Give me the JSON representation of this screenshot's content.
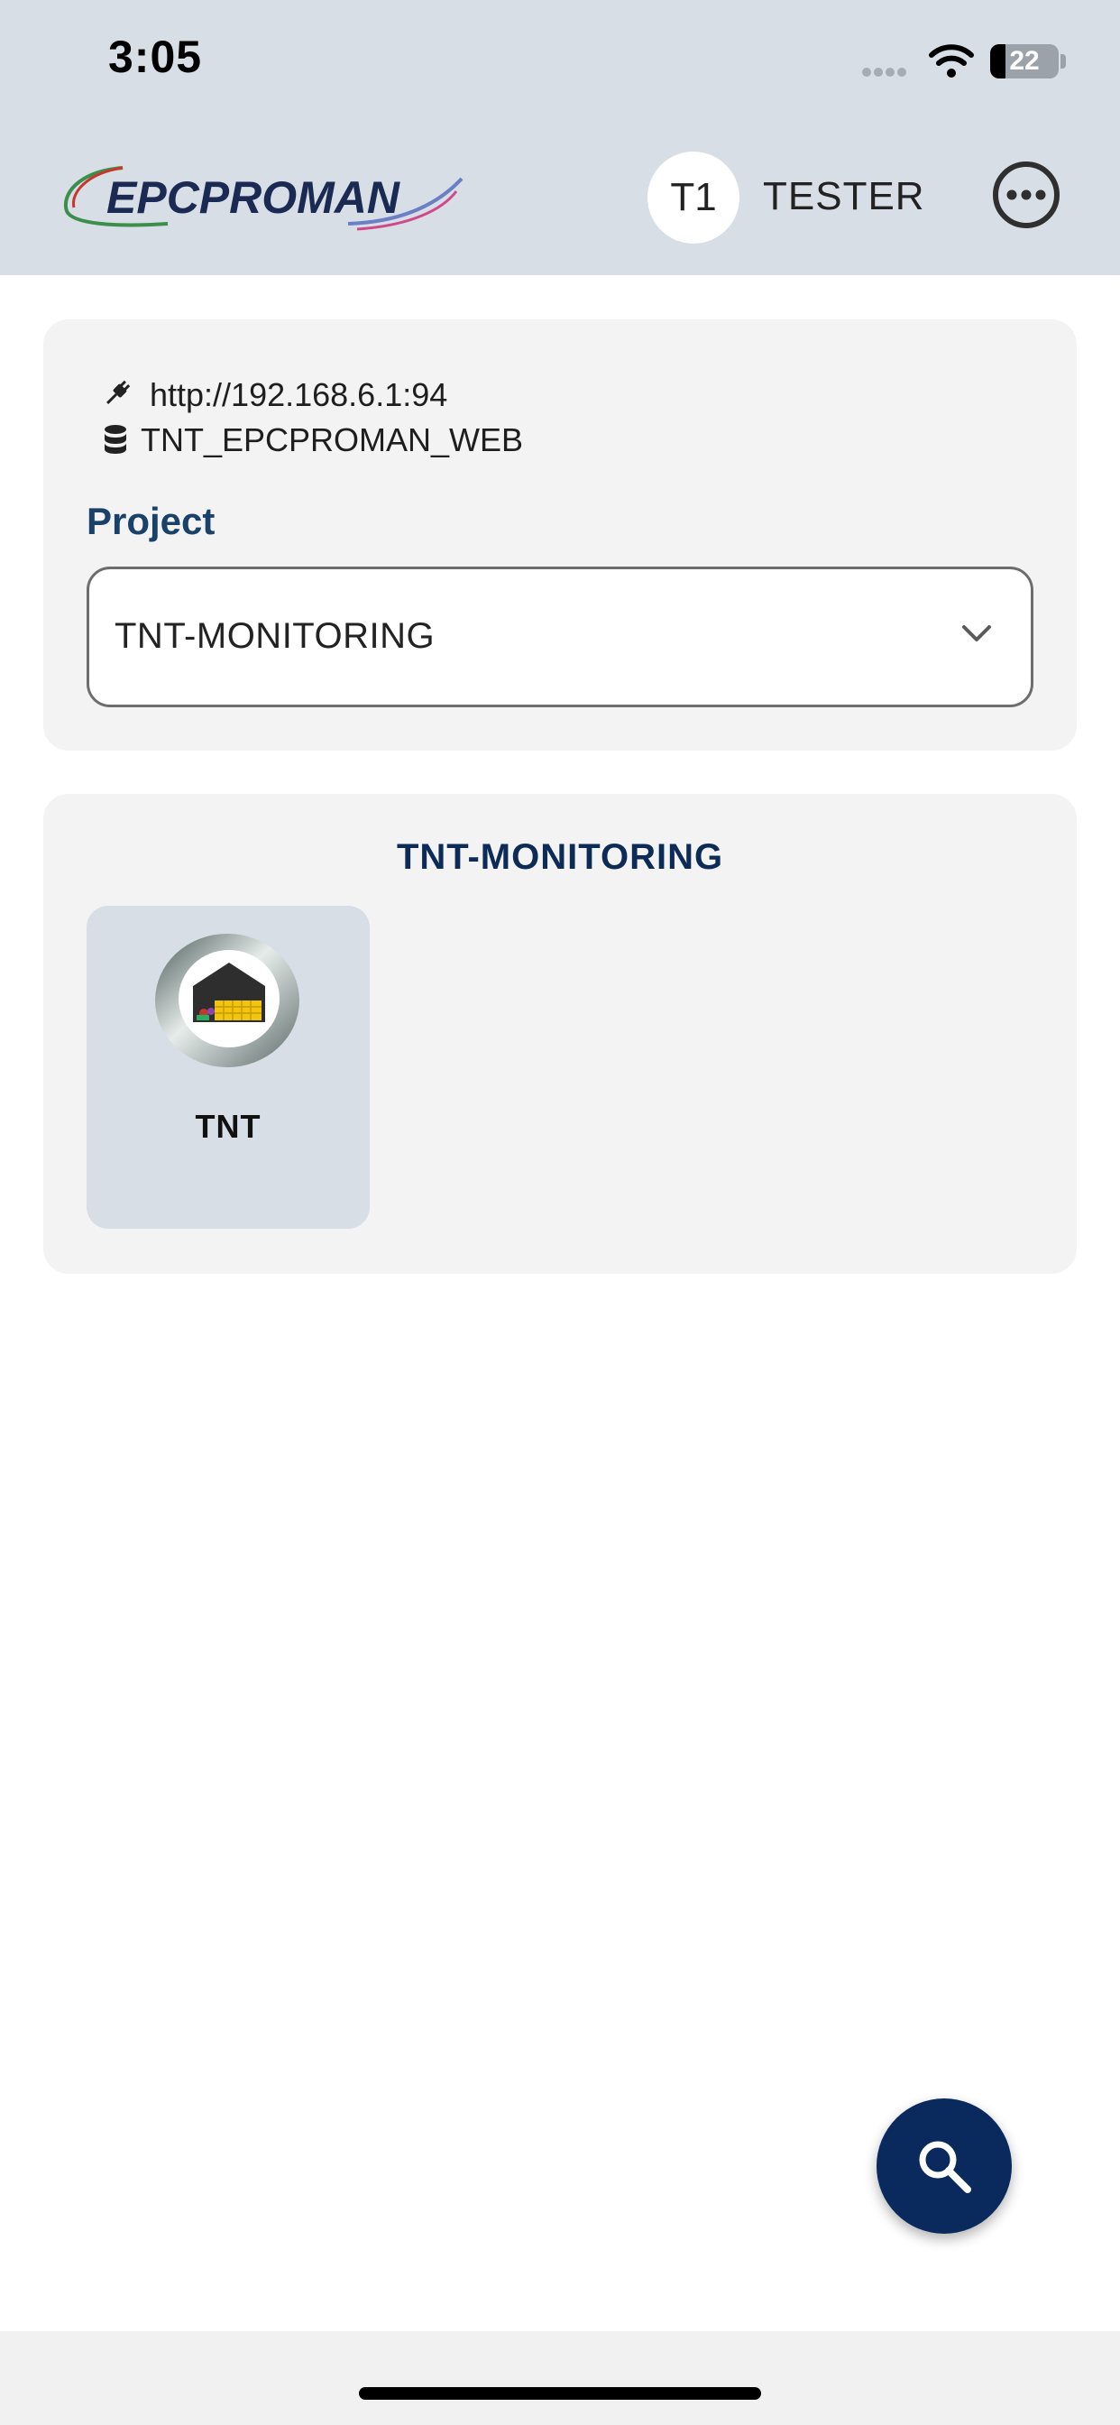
{
  "status_bar": {
    "time": "3:05",
    "battery": "22",
    "battery_level": 0.22
  },
  "header": {
    "logo_text": "EPCPROMAN",
    "avatar_initials": "T1",
    "user_name": "TESTER",
    "more_icon": "more-horizontal-circle-icon"
  },
  "connection": {
    "server_icon": "plug-icon",
    "server_url": "http://192.168.6.1:94",
    "db_icon": "database-icon",
    "database": "TNT_EPCPROMAN_WEB"
  },
  "project_selector": {
    "label": "Project",
    "selected": "TNT-MONITORING",
    "chevron_icon": "chevron-down-icon"
  },
  "modules_card": {
    "title": "TNT-MONITORING",
    "tiles": [
      {
        "label": "TNT",
        "icon": "warehouse-icon"
      }
    ]
  },
  "fab": {
    "icon": "search-icon"
  },
  "colors": {
    "header_bg": "#d7dee6",
    "card_bg": "#f3f3f3",
    "accent_label": "#1a4169",
    "title_navy": "#0d2b57",
    "fab_bg": "#0a2a5e"
  }
}
